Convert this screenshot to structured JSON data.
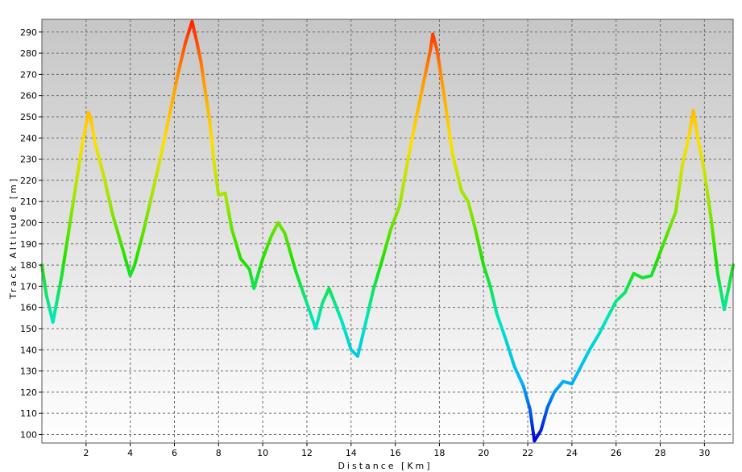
{
  "chart_data": {
    "type": "line",
    "title": "",
    "xlabel": "Distance [Km]",
    "ylabel": "Track Altitude [m]",
    "xlim": [
      0,
      31.3
    ],
    "ylim": [
      96,
      296
    ],
    "x_ticks": [
      2,
      4,
      6,
      8,
      10,
      12,
      14,
      16,
      18,
      20,
      22,
      24,
      26,
      28,
      30
    ],
    "y_ticks": [
      100,
      110,
      120,
      130,
      140,
      150,
      160,
      170,
      180,
      190,
      200,
      210,
      220,
      230,
      240,
      250,
      260,
      270,
      280,
      290
    ],
    "grid": true,
    "legend": "none",
    "color_scale": {
      "min_value": 97,
      "max_value": 295,
      "stops": [
        "#0000e0",
        "#00b4ff",
        "#00e8c0",
        "#20e000",
        "#9ae600",
        "#ffe000",
        "#ff9a00",
        "#ff2000"
      ]
    },
    "series": [
      {
        "x": [
          0.0,
          0.2,
          0.5,
          0.9,
          1.2,
          1.5,
          1.8,
          2.1,
          2.2,
          2.4,
          2.8,
          3.2,
          3.7,
          4.0,
          4.2,
          4.6,
          5.0,
          5.4,
          5.8,
          6.2,
          6.5,
          6.8,
          7.0,
          7.2,
          7.4,
          7.6,
          7.8,
          8.0,
          8.3,
          8.6,
          9.0,
          9.4,
          9.6,
          10.0,
          10.4,
          10.7,
          11.0,
          11.5,
          12.0,
          12.4,
          12.7,
          13.0,
          13.3,
          13.6,
          14.0,
          14.3,
          14.6,
          15.0,
          15.4,
          15.8,
          16.2,
          16.6,
          17.0,
          17.4,
          17.6,
          17.7,
          17.9,
          18.2,
          18.6,
          19.0,
          19.3,
          19.6,
          20.0,
          20.3,
          20.6,
          21.0,
          21.4,
          21.8,
          22.1,
          22.3,
          22.6,
          22.9,
          23.2,
          23.6,
          24.0,
          24.4,
          24.8,
          25.2,
          25.6,
          26.0,
          26.4,
          26.8,
          27.2,
          27.6,
          28.0,
          28.4,
          28.7,
          29.0,
          29.3,
          29.5,
          29.7,
          30.0,
          30.3,
          30.6,
          30.9,
          31.3
        ],
        "values": [
          180,
          166,
          153,
          175,
          195,
          215,
          235,
          252,
          250,
          238,
          222,
          204,
          186,
          175,
          180,
          196,
          214,
          232,
          252,
          272,
          285,
          295,
          286,
          276,
          262,
          248,
          228,
          213,
          214,
          197,
          183,
          178,
          169,
          183,
          194,
          200,
          195,
          177,
          162,
          150,
          162,
          169,
          161,
          153,
          140,
          137,
          150,
          168,
          182,
          197,
          208,
          231,
          252,
          272,
          282,
          289,
          281,
          261,
          232,
          215,
          210,
          198,
          180,
          170,
          157,
          145,
          132,
          123,
          112,
          97,
          102,
          113,
          120,
          125,
          124,
          132,
          140,
          147,
          155,
          163,
          167,
          176,
          174,
          175,
          186,
          197,
          205,
          227,
          241,
          253,
          240,
          224,
          202,
          176,
          159,
          180
        ]
      }
    ]
  }
}
